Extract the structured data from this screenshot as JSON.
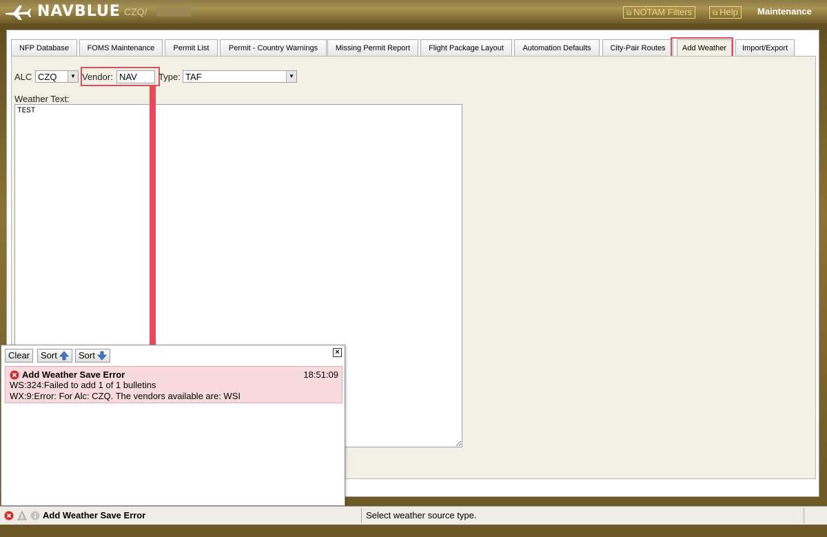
{
  "header": {
    "logo_text": "NAVBLUE",
    "org": "CZQ/",
    "notam_filters": "NOTAM Filters",
    "help": "Help",
    "title": "Maintenance"
  },
  "tabs": [
    {
      "label": "NFP Database"
    },
    {
      "label": "FOMS Maintenance"
    },
    {
      "label": "Permit List"
    },
    {
      "label": "Permit - Country Warnings"
    },
    {
      "label": "Missing Permit Report"
    },
    {
      "label": "Flight Package Layout"
    },
    {
      "label": "Automation Defaults"
    },
    {
      "label": "City-Pair Routes"
    },
    {
      "label": "Add Weather",
      "active": true
    },
    {
      "label": "Import/Export"
    }
  ],
  "form": {
    "alc_label": "ALC",
    "alc_value": "CZQ",
    "vendor_label": "Vendor:",
    "vendor_value": "NAV",
    "type_label": "Type:",
    "type_value": "TAF",
    "weather_text_label": "Weather Text:",
    "weather_text_value": "TEST"
  },
  "popup": {
    "clear": "Clear",
    "sort_asc": "Sort",
    "sort_desc": "Sort",
    "message": {
      "title": "Add Weather Save Error",
      "time": "18:51:09",
      "line1": "WS:324:Failed to add 1 of 1 bulletins",
      "line2": "WX:9:Error: For Alc: CZQ. The vendors available are: WSI"
    }
  },
  "status": {
    "left": "Add Weather Save Error",
    "right": "Select weather source type."
  },
  "colors": {
    "highlight": "#e8485a",
    "error_bg": "#f9dbde",
    "header_gold": "#a89252"
  }
}
